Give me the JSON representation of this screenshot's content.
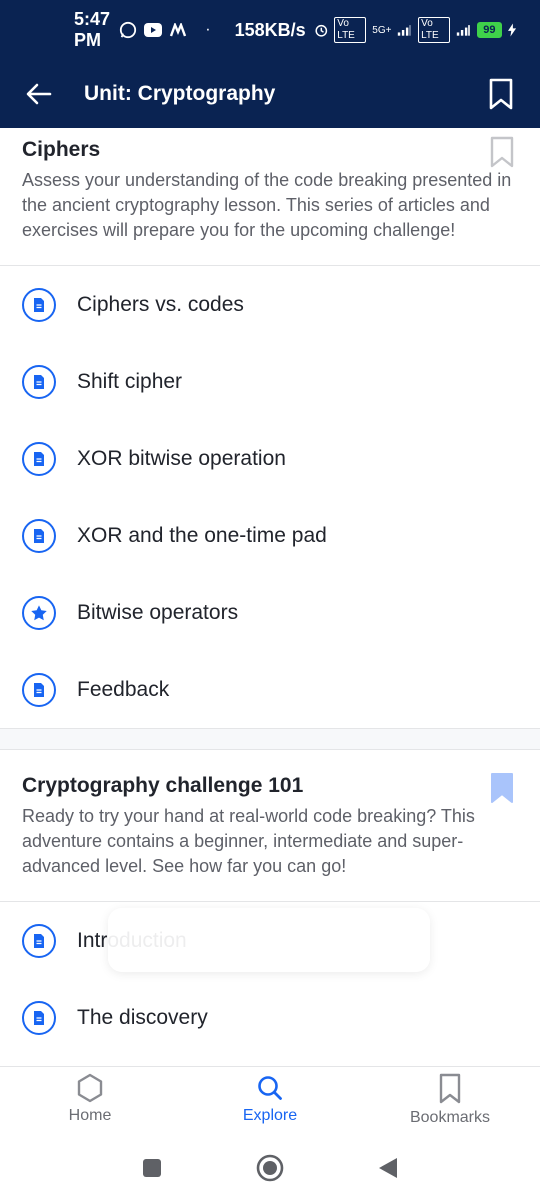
{
  "status": {
    "time": "5:47 PM",
    "speed": "158KB/s",
    "battery": "99",
    "net_label": "5G+",
    "volte_label": "Vo LTE",
    "icons": [
      "whatsapp-icon",
      "youtube-icon",
      "m-icon",
      "dot-icon",
      "alarm-icon",
      "volte-icon",
      "signal-icon",
      "battery-icon",
      "charging-icon"
    ]
  },
  "appbar": {
    "title": "Unit: Cryptography"
  },
  "sections": [
    {
      "title": "Ciphers",
      "description": "Assess your understanding of the code breaking presented in the ancient cryptography lesson. This series of articles and exercises will prepare you for the upcoming challenge!",
      "bookmarked": false,
      "items": [
        {
          "label": "Ciphers vs. codes",
          "icon": "article-icon"
        },
        {
          "label": "Shift cipher",
          "icon": "article-icon"
        },
        {
          "label": "XOR bitwise operation",
          "icon": "article-icon"
        },
        {
          "label": "XOR and the one-time pad",
          "icon": "article-icon"
        },
        {
          "label": "Bitwise operators",
          "icon": "star-icon"
        },
        {
          "label": "Feedback",
          "icon": "article-icon"
        }
      ]
    },
    {
      "title": "Cryptography challenge 101",
      "description": "Ready to try your hand at real-world code breaking? This adventure contains a beginner, intermediate and super-advanced level. See how far you can go!",
      "bookmarked": true,
      "items": [
        {
          "label": "Introduction",
          "icon": "article-icon"
        },
        {
          "label": "The discovery",
          "icon": "article-icon"
        }
      ]
    }
  ],
  "bottom_nav": [
    {
      "label": "Home",
      "icon": "hexagon-icon",
      "active": false
    },
    {
      "label": "Explore",
      "icon": "search-icon",
      "active": true
    },
    {
      "label": "Bookmarks",
      "icon": "bookmark-icon",
      "active": false
    }
  ],
  "colors": {
    "header": "#0a2352",
    "accent": "#1865f2",
    "bookmark_inactive": "#c4c5c9",
    "bookmark_active": "#a9c4fb"
  }
}
